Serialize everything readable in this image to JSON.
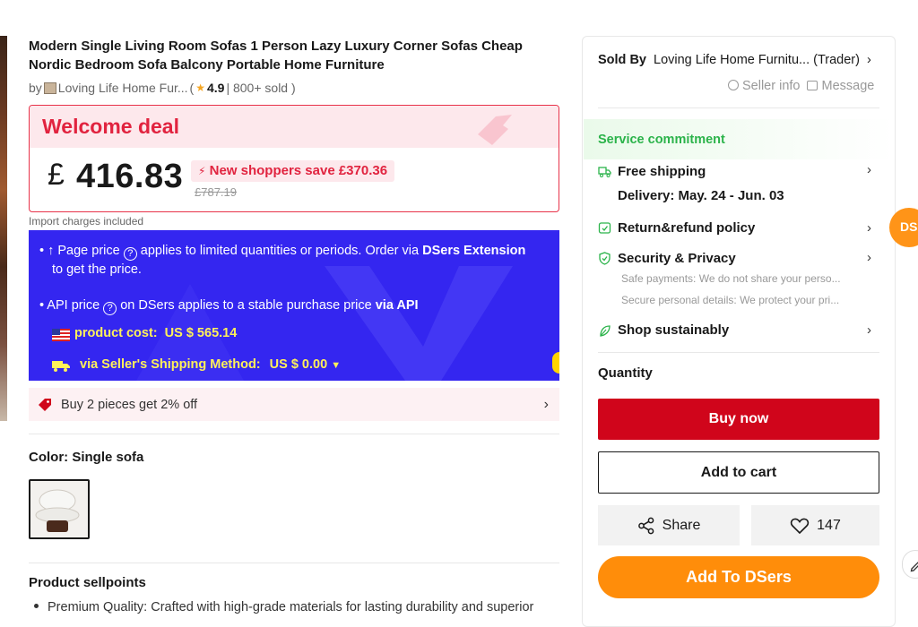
{
  "product": {
    "title": "Modern Single Living Room Sofas 1 Person Lazy Luxury Corner Sofas Cheap Nordic Bedroom Sofa Balcony Portable Home Furniture",
    "by_prefix": "by",
    "store_name": "Loving Life Home Fur...",
    "rating_open": "(",
    "rating": "4.9",
    "sold": "| 800+ sold )"
  },
  "deal": {
    "title": "Welcome deal",
    "currency": "£",
    "price": "416.83",
    "save_text": "New shoppers save  £370.36",
    "original_price": "£787.19"
  },
  "import_note": "Import charges included",
  "dsers": {
    "line1_a": "• ↑ Page price",
    "line1_b": "applies to limited quantities or periods. Order via",
    "line1_link": "DSers Extension",
    "line1_c": "to get the price.",
    "line2_a": "• API price",
    "line2_b": "on DSers applies to a stable purchase price",
    "line2_link": "via API",
    "product_cost_label": "product cost:",
    "product_cost_value": "US $ 565.14",
    "shipping_label": "via Seller's Shipping Method:",
    "shipping_value": "US $ 0.00"
  },
  "bulk": {
    "text": "Buy 2 pieces get 2% off"
  },
  "color": {
    "label": "Color: Single sofa"
  },
  "sellpoints": {
    "title": "Product sellpoints",
    "item1": "Premium Quality: Crafted with high-grade materials for lasting durability and superior"
  },
  "seller": {
    "sold_by": "Sold By",
    "name": "Loving Life Home Furnitu... (Trader)",
    "info": "Seller info",
    "message": "Message"
  },
  "service": {
    "title": "Service commitment",
    "free_shipping": "Free shipping",
    "delivery": "Delivery: May. 24 - Jun. 03",
    "return": "Return&refund policy",
    "security": "Security & Privacy",
    "security_sub1": "Safe payments: We do not share your perso...",
    "security_sub2": "Secure personal details: We protect your pri...",
    "sustain": "Shop sustainably"
  },
  "quantity_label": "Quantity",
  "buttons": {
    "buy_now": "Buy now",
    "add_to_cart": "Add to cart",
    "share": "Share",
    "likes": "147",
    "add_to_dsers": "Add To DSers"
  },
  "floating": {
    "ds": "DS"
  },
  "colors": {
    "accent_red": "#d0051b",
    "deal_red": "#e1233f",
    "dsers_blue": "#3426f0",
    "dsers_orange": "#ff8d0a",
    "service_green": "#2bb34a"
  }
}
